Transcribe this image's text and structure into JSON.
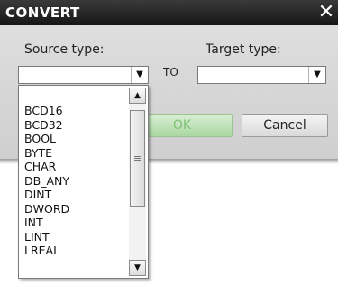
{
  "dialog": {
    "title": "CONVERT",
    "close_glyph": "✕",
    "source_label": "Source type:",
    "target_label": "Target type:",
    "to_label": "_TO_",
    "ok_label": "OK",
    "cancel_label": "Cancel",
    "source_value": "",
    "target_value": ""
  },
  "dropdown": {
    "options": [
      "BCD16",
      "BCD32",
      "BOOL",
      "BYTE",
      "CHAR",
      "DB_ANY",
      "DINT",
      "DWORD",
      "INT",
      "LINT",
      "LREAL"
    ]
  },
  "icons": {
    "arrow_down": "▼",
    "scroll_up": "▲",
    "scroll_down": "▼",
    "thumb_grip": "≡"
  },
  "colors": {
    "titlebar": "#1e1e1e",
    "ok_accent": "#a9d7a1"
  }
}
